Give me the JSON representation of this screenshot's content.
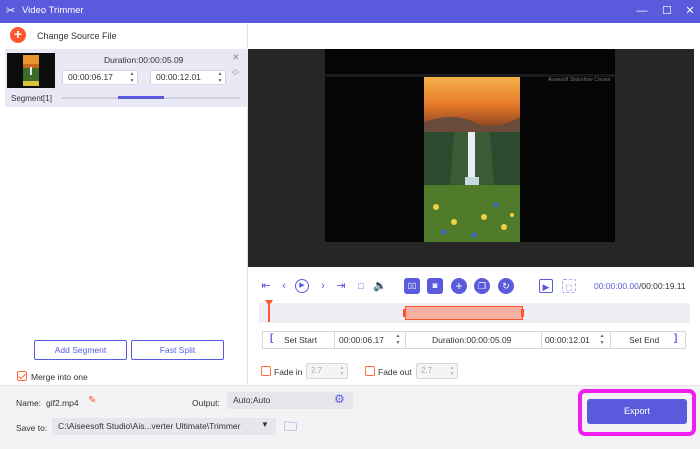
{
  "window": {
    "title": "Video Trimmer",
    "app_icon": "scissors-icon",
    "controls": [
      "minimize-icon",
      "maximize-icon",
      "close-icon"
    ]
  },
  "source": {
    "change_label": "Change Source File"
  },
  "segment": {
    "duration": "Duration:00:00:05.09",
    "start": "00:00:06.17",
    "end": "00:00:12.01",
    "label": "Segment[1]"
  },
  "left_buttons": {
    "add_segment": "Add Segment",
    "fast_split": "Fast Split"
  },
  "merge": {
    "label": "Merge into one",
    "checked": true
  },
  "preview": {
    "watermark": "Aiseesoft Slideshow Creator"
  },
  "playback": {
    "current_time": "00:00:00.00",
    "total_time": "/00:00:19.11"
  },
  "trim": {
    "set_start": "Set Start",
    "start": "00:00:06.17",
    "duration": "Duration:00:00:05.09",
    "end": "00:00:12.01",
    "set_end": "Set End"
  },
  "fade": {
    "fade_in_label": "Fade in",
    "fade_in_value": "2.7",
    "fade_out_label": "Fade out",
    "fade_out_value": "2.7"
  },
  "output": {
    "name_label": "Name:",
    "name_value": "gif2.mp4",
    "output_label": "Output:",
    "output_value": "Auto;Auto",
    "save_label": "Save to:",
    "save_path": "C:\\Aiseesoft Studio\\Ais...verter Ultimate\\Trimmer",
    "export_label": "Export"
  },
  "colors": {
    "accent": "#5a5bdc",
    "orange": "#ff5630",
    "highlight": "#f01ef0"
  }
}
